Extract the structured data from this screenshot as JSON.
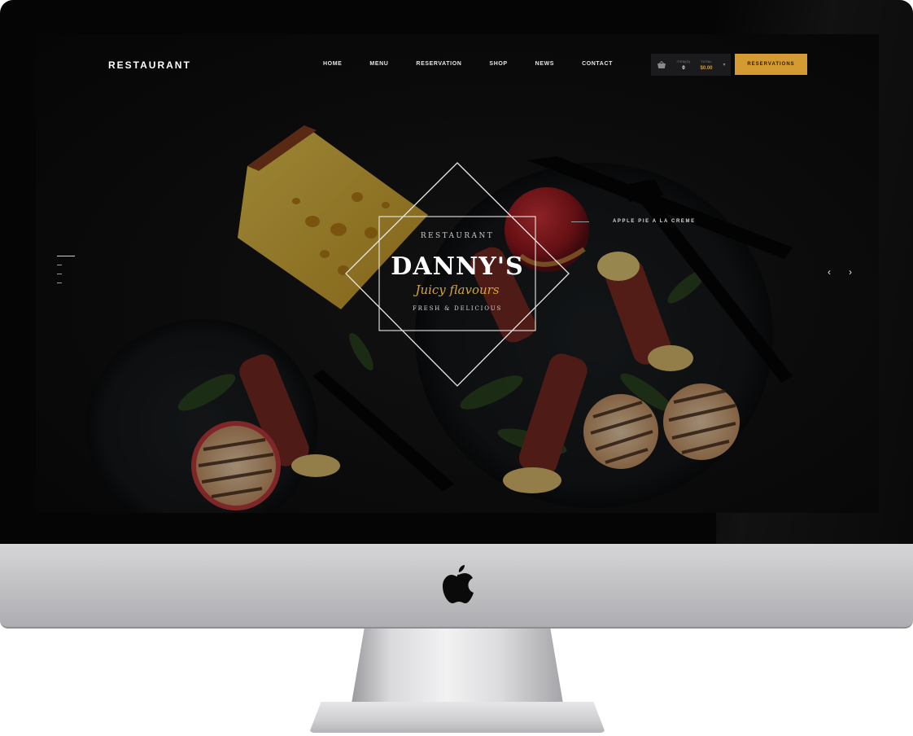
{
  "site": {
    "brand": "RESTAURANT",
    "nav": [
      "HOME",
      "MENU",
      "RESERVATION",
      "SHOP",
      "NEWS",
      "CONTACT"
    ],
    "cart": {
      "icon": "basket-icon",
      "items_label": "ITEM(S)",
      "items_value": "0",
      "total_label": "TOTAL",
      "total_value": "$0.00"
    },
    "reservations_button": "RESERVATIONS"
  },
  "hero": {
    "emblem": {
      "line1": "RESTAURANT",
      "line2": "DANNY'S",
      "line3": "Juicy flavours",
      "line4": "FRESH & DELICIOUS"
    },
    "caption": "APPLE PIE A LA CREME",
    "prev_icon": "chevron-left-icon",
    "next_icon": "chevron-right-icon"
  },
  "colors": {
    "accent": "#d49b32",
    "screen_bg": "#111112"
  },
  "device": {
    "logo_icon": "apple-logo-icon"
  }
}
